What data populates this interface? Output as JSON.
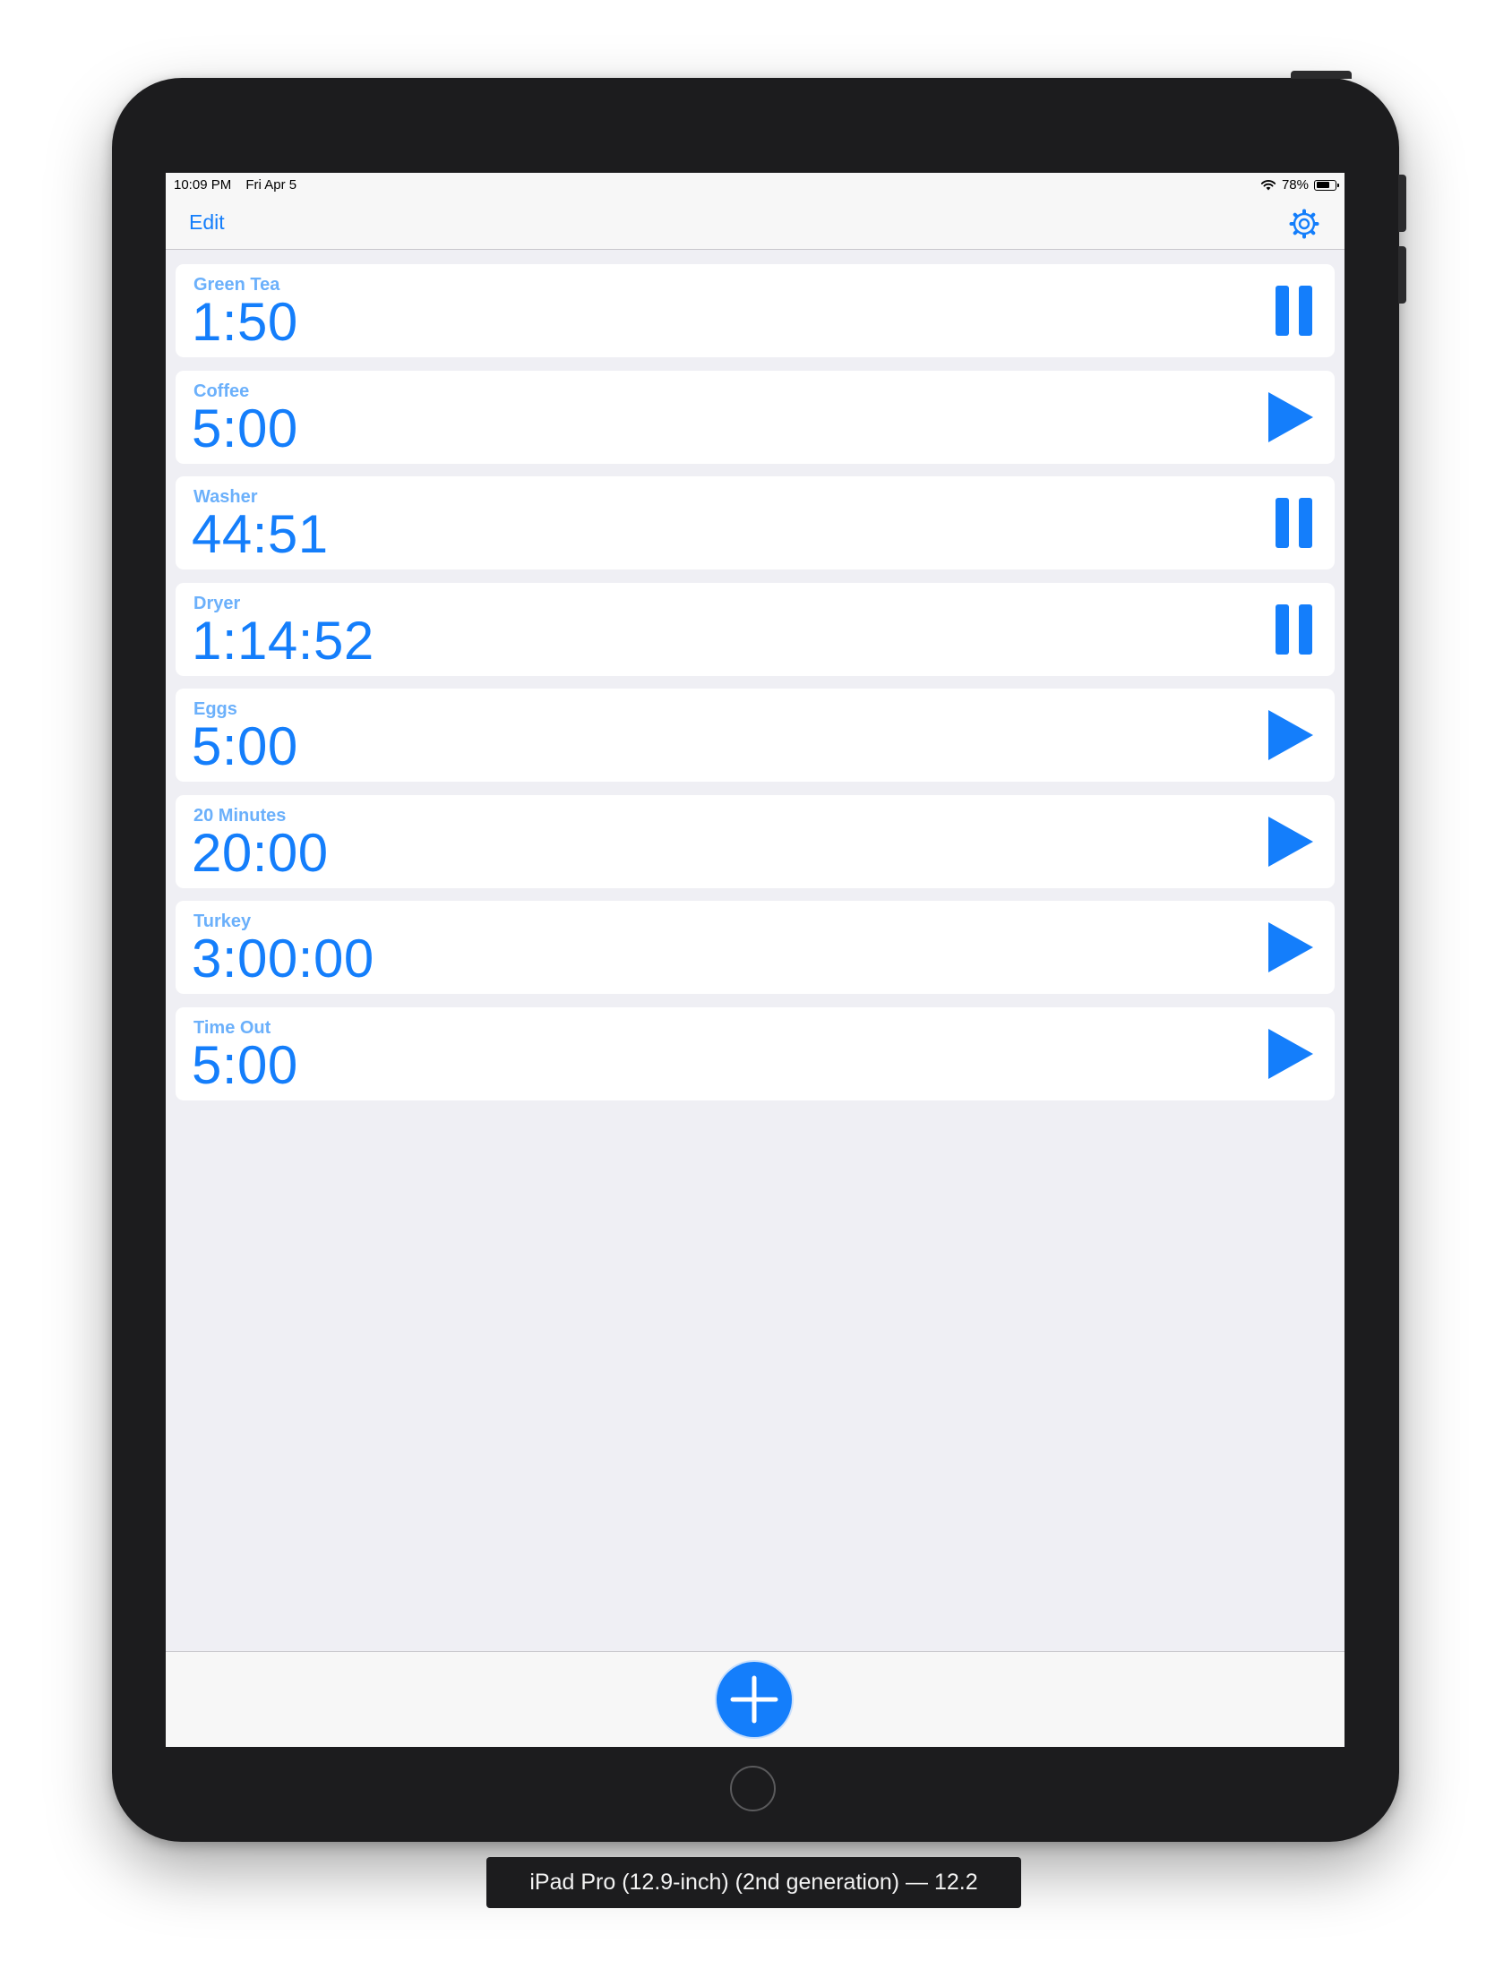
{
  "status_bar": {
    "time": "10:09 PM",
    "date": "Fri Apr 5",
    "battery": "78%",
    "battery_level": 0.78,
    "wifi_icon": "wifi-icon"
  },
  "nav": {
    "edit_label": "Edit",
    "settings_icon": "gear-icon"
  },
  "accent_color": "#147efb",
  "timers": [
    {
      "name": "Green Tea",
      "time": "1:50",
      "state": "running",
      "icon": "pause-icon"
    },
    {
      "name": "Coffee",
      "time": "5:00",
      "state": "stopped",
      "icon": "play-icon"
    },
    {
      "name": "Washer",
      "time": "44:51",
      "state": "running",
      "icon": "pause-icon"
    },
    {
      "name": "Dryer",
      "time": "1:14:52",
      "state": "running",
      "icon": "pause-icon"
    },
    {
      "name": "Eggs",
      "time": "5:00",
      "state": "stopped",
      "icon": "play-icon"
    },
    {
      "name": "20 Minutes",
      "time": "20:00",
      "state": "stopped",
      "icon": "play-icon"
    },
    {
      "name": "Turkey",
      "time": "3:00:00",
      "state": "stopped",
      "icon": "play-icon"
    },
    {
      "name": "Time Out",
      "time": "5:00",
      "state": "stopped",
      "icon": "play-icon"
    }
  ],
  "toolbar": {
    "add_icon": "plus-icon"
  },
  "simulator_label": "iPad Pro (12.9-inch) (2nd generation) — 12.2"
}
